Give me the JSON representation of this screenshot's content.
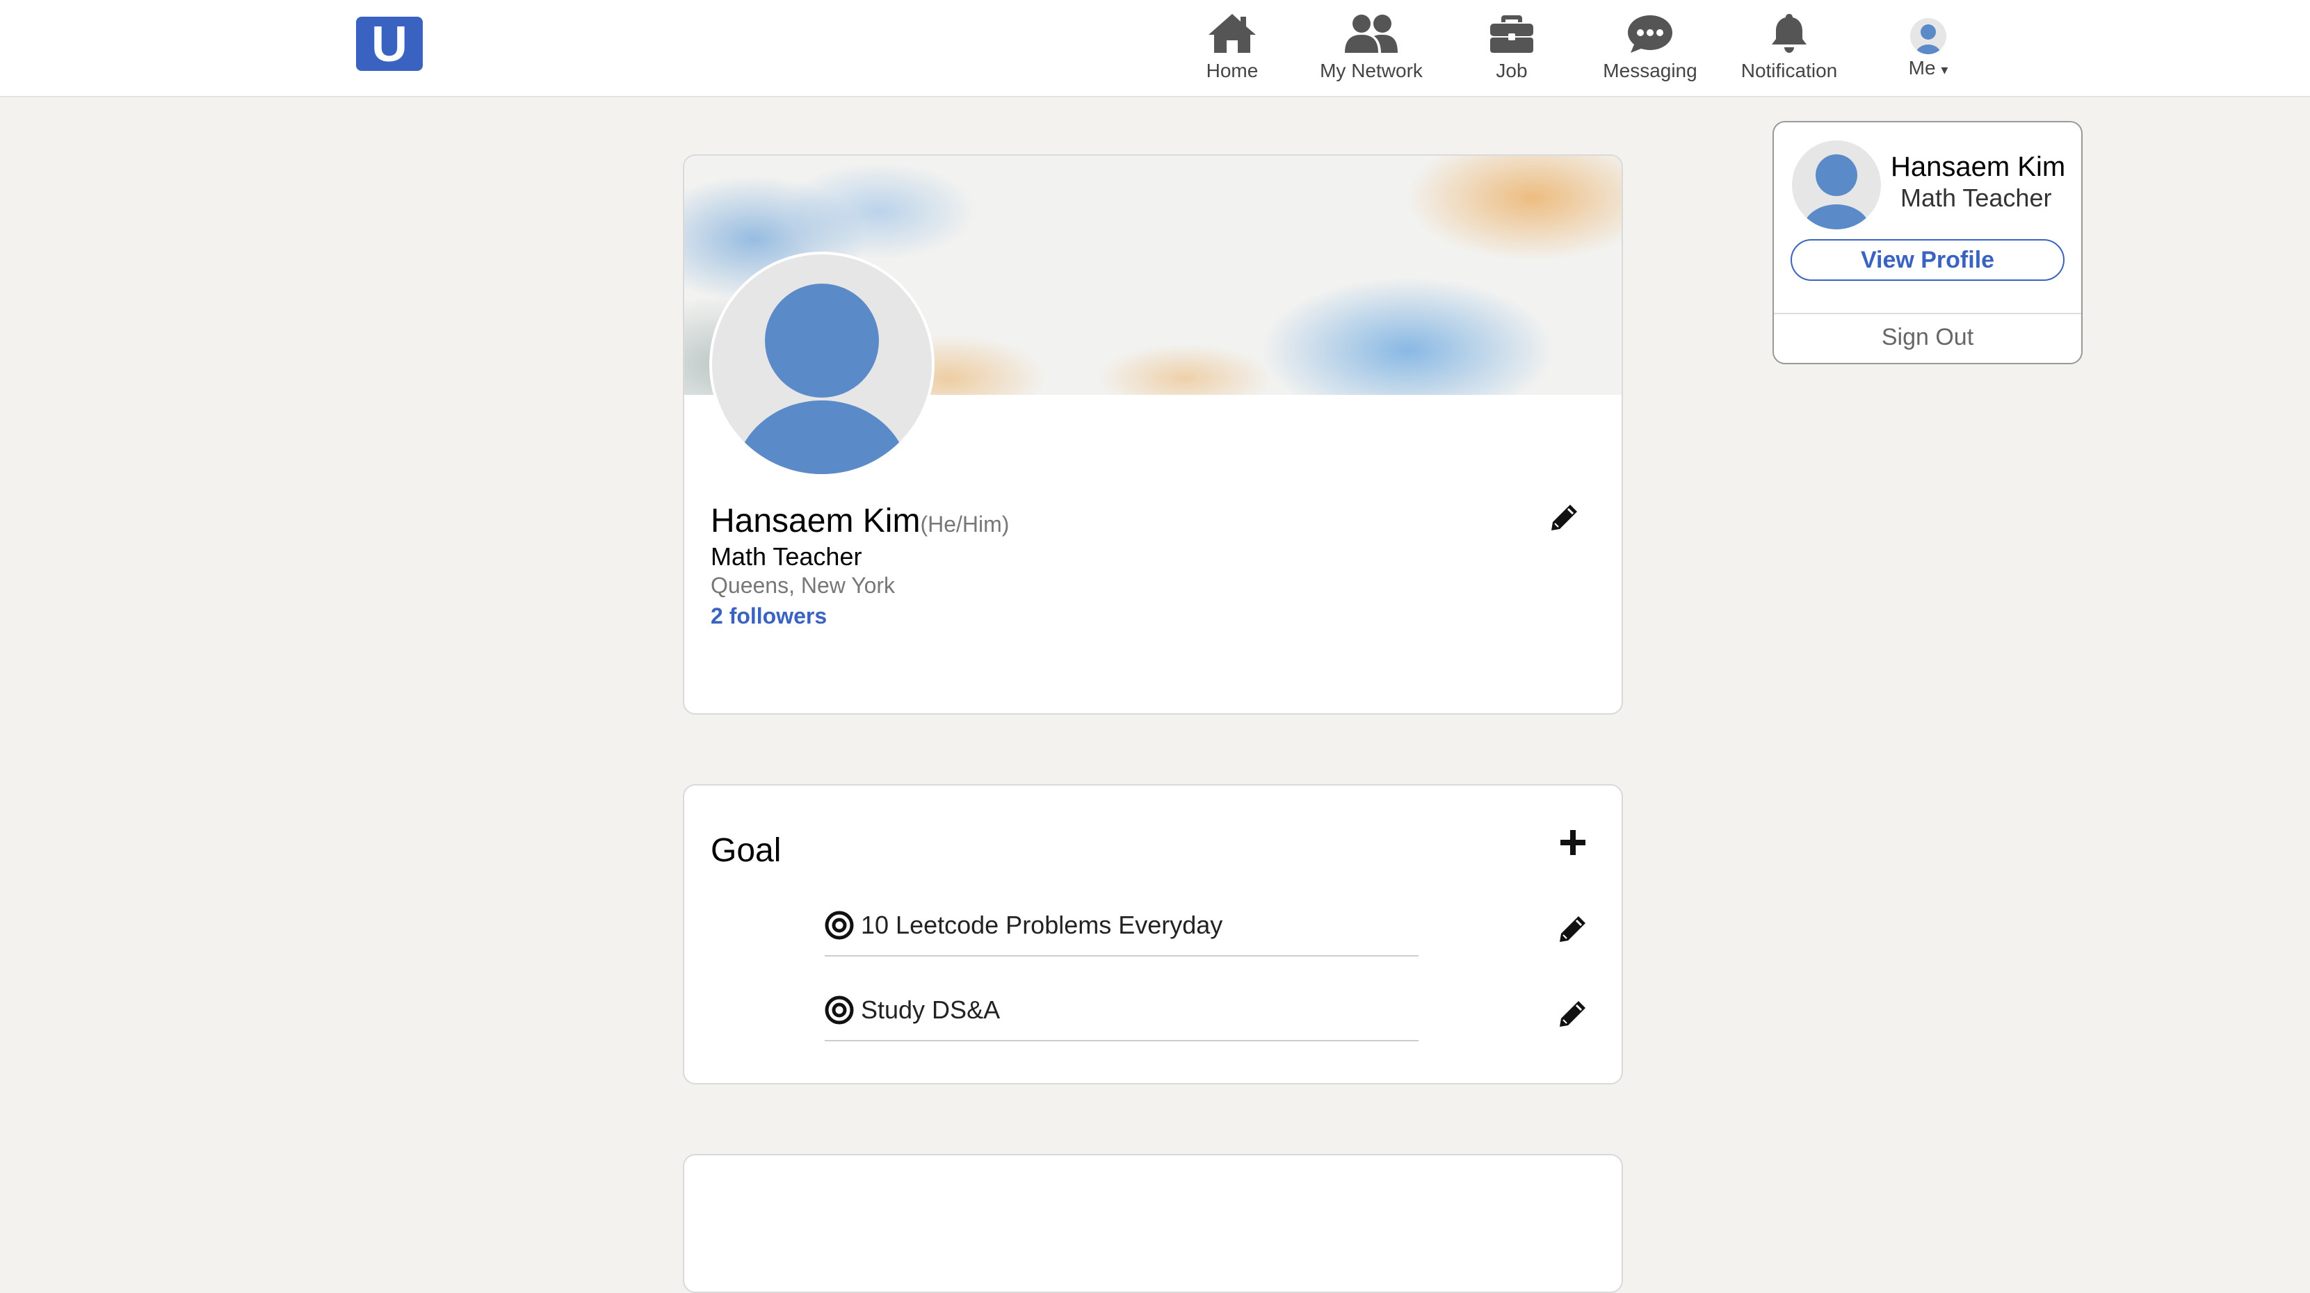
{
  "header": {
    "logo": "U",
    "nav": [
      {
        "label": "Home",
        "icon": "home-icon"
      },
      {
        "label": "My Network",
        "icon": "network-icon"
      },
      {
        "label": "Job",
        "icon": "briefcase-icon"
      },
      {
        "label": "Messaging",
        "icon": "messaging-icon"
      },
      {
        "label": "Notification",
        "icon": "bell-icon"
      }
    ],
    "me_label": "Me"
  },
  "dropdown": {
    "name": "Hansaem Kim",
    "title": "Math Teacher",
    "view_profile": "View Profile",
    "sign_out": "Sign Out"
  },
  "profile": {
    "name": "Hansaem Kim",
    "pronouns": "(He/Him)",
    "title": "Math Teacher",
    "location": "Queens, New York",
    "followers": "2 followers"
  },
  "goal": {
    "heading": "Goal",
    "items": [
      {
        "text": "10 Leetcode Problems Everyday"
      },
      {
        "text": "Study DS&A"
      }
    ]
  },
  "colors": {
    "accent": "#3a63c1",
    "avatar": "#5b8ac9",
    "page_bg": "#f3f2ef"
  }
}
